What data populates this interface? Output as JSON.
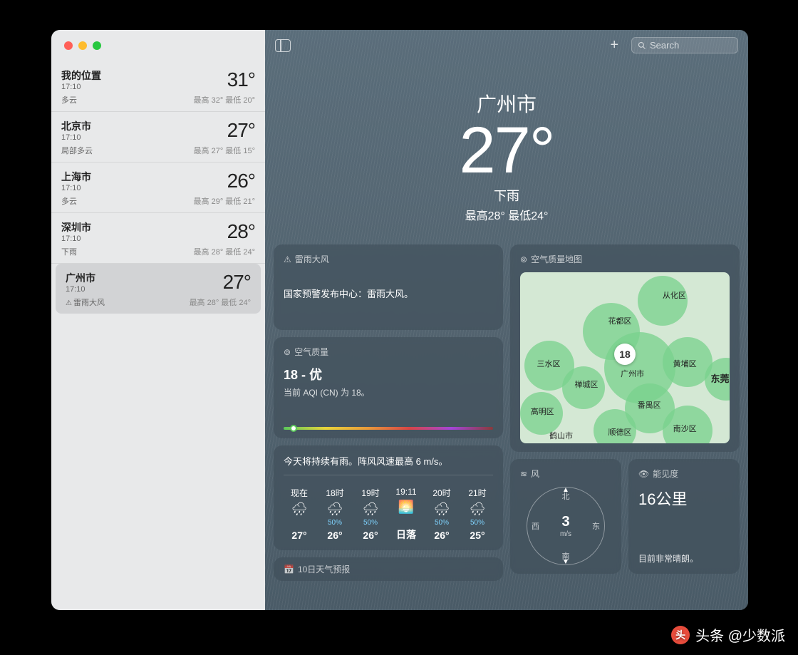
{
  "search": {
    "placeholder": "Search"
  },
  "sidebar": {
    "locations": [
      {
        "name": "我的位置",
        "time": "17:10",
        "condition": "多云",
        "temp": "31°",
        "high": "最高 32°",
        "low": "最低 20°",
        "selected": false,
        "warn": false
      },
      {
        "name": "北京市",
        "time": "17:10",
        "condition": "局部多云",
        "temp": "27°",
        "high": "最高 27°",
        "low": "最低 15°",
        "selected": false,
        "warn": false
      },
      {
        "name": "上海市",
        "time": "17:10",
        "condition": "多云",
        "temp": "26°",
        "high": "最高 29°",
        "low": "最低 21°",
        "selected": false,
        "warn": false
      },
      {
        "name": "深圳市",
        "time": "17:10",
        "condition": "下雨",
        "temp": "28°",
        "high": "最高 28°",
        "low": "最低 24°",
        "selected": false,
        "warn": false
      },
      {
        "name": "广州市",
        "time": "17:10",
        "condition": "雷雨大风",
        "temp": "27°",
        "high": "最高 28°",
        "low": "最低 24°",
        "selected": true,
        "warn": true
      }
    ]
  },
  "hero": {
    "city": "广州市",
    "temp": "27°",
    "condition": "下雨",
    "hilo": "最高28°  最低24°"
  },
  "alert": {
    "title": "雷雨大风",
    "body": "国家预警发布中心：雷雨大风。"
  },
  "aqi": {
    "title": "空气质量",
    "value": "18 - 优",
    "desc": "当前 AQI (CN) 为 18。"
  },
  "aqiMap": {
    "title": "空气质量地图",
    "center": "18",
    "labels": [
      "从化区",
      "花都区",
      "三水区",
      "黄埔区",
      "广州市",
      "禅城区",
      "东莞",
      "高明区",
      "番禺区",
      "鹤山市",
      "顺德区",
      "南沙区"
    ]
  },
  "hourly": {
    "summary": "今天将持续有雨。阵风风速最高 6 m/s。",
    "hours": [
      {
        "label": "现在",
        "icon": "🌧",
        "precip": "",
        "temp": "27°"
      },
      {
        "label": "18时",
        "icon": "🌧",
        "precip": "50%",
        "temp": "26°"
      },
      {
        "label": "19时",
        "icon": "🌧",
        "precip": "50%",
        "temp": "26°"
      },
      {
        "label": "19:11",
        "icon": "🌅",
        "precip": "",
        "temp": "日落"
      },
      {
        "label": "20时",
        "icon": "🌧",
        "precip": "50%",
        "temp": "26°"
      },
      {
        "label": "21时",
        "icon": "🌧",
        "precip": "50%",
        "temp": "25°"
      }
    ]
  },
  "forecast": {
    "title": "10日天气预报"
  },
  "wind": {
    "title": "风",
    "speed": "3",
    "unit": "m/s",
    "n": "北",
    "s": "南",
    "e": "东",
    "w": "西"
  },
  "visibility": {
    "title": "能见度",
    "value": "16公里",
    "desc": "目前非常晴朗。"
  },
  "watermark": "头条 @少数派"
}
